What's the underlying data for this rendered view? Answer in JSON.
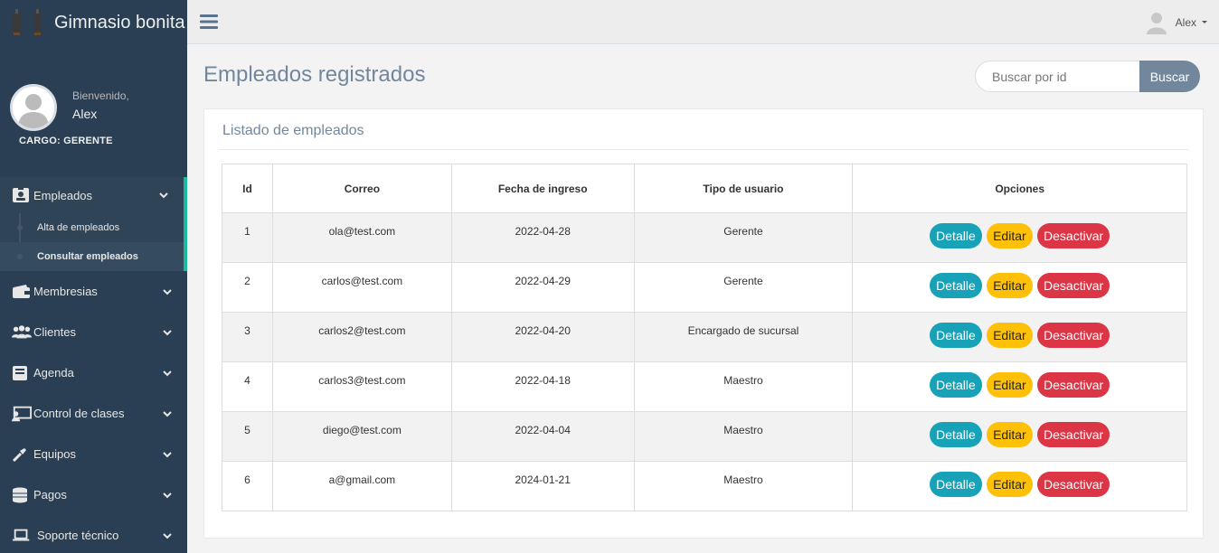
{
  "app": {
    "title": "Gimnasio bonita"
  },
  "profile": {
    "welcome": "Bienvenido,",
    "name": "Alex",
    "role": "CARGO: GERENTE"
  },
  "sidebar": {
    "items": [
      {
        "label": "Empleados",
        "icon": "id-badge-icon",
        "expanded": true,
        "children": [
          {
            "label": "Alta de empleados"
          },
          {
            "label": "Consultar empleados"
          }
        ]
      },
      {
        "label": "Membresias",
        "icon": "wallet-icon"
      },
      {
        "label": "Clientes",
        "icon": "users-icon"
      },
      {
        "label": "Agenda",
        "icon": "book-icon"
      },
      {
        "label": "Control de clases",
        "icon": "chalkboard-teacher-icon"
      },
      {
        "label": "Equipos",
        "icon": "tools-icon"
      },
      {
        "label": "Pagos",
        "icon": "coins-icon"
      },
      {
        "label": "Soporte técnico",
        "icon": "laptop-icon"
      }
    ]
  },
  "topnav": {
    "user": "Alex"
  },
  "page": {
    "title": "Empleados registrados",
    "search": {
      "placeholder": "Buscar por id",
      "button": "Buscar"
    },
    "panel_title": "Listado de empleados"
  },
  "table": {
    "headers": [
      "Id",
      "Correo",
      "Fecha de ingreso",
      "Tipo de usuario",
      "Opciones"
    ],
    "rows": [
      {
        "id": "1",
        "email": "ola@test.com",
        "date": "2022-04-28",
        "type": "Gerente"
      },
      {
        "id": "2",
        "email": "carlos@test.com",
        "date": "2022-04-29",
        "type": "Gerente"
      },
      {
        "id": "3",
        "email": "carlos2@test.com",
        "date": "2022-04-20",
        "type": "Encargado de sucursal"
      },
      {
        "id": "4",
        "email": "carlos3@test.com",
        "date": "2022-04-18",
        "type": "Maestro"
      },
      {
        "id": "5",
        "email": "diego@test.com",
        "date": "2022-04-04",
        "type": "Maestro"
      },
      {
        "id": "6",
        "email": "a@gmail.com",
        "date": "2024-01-21",
        "type": "Maestro"
      }
    ],
    "actions": {
      "detail": "Detalle",
      "edit": "Editar",
      "deactivate": "Desactivar"
    }
  },
  "colors": {
    "sidebar": "#2a3f54",
    "accent": "#1abb9c",
    "info": "#17a2b8",
    "warning": "#ffc107",
    "danger": "#dc3545",
    "title": "#73879c"
  }
}
